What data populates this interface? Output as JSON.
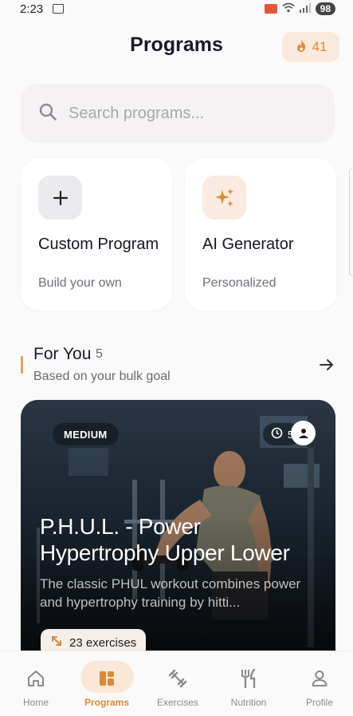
{
  "status_bar": {
    "time": "2:23",
    "battery": "98"
  },
  "header": {
    "title": "Programs",
    "streak_count": "41"
  },
  "search": {
    "placeholder": "Search programs..."
  },
  "quick_actions": [
    {
      "title": "Custom Program",
      "subtitle": "Build your own",
      "icon": "plus-icon"
    },
    {
      "title": "AI Generator",
      "subtitle": "Personalized",
      "icon": "sparkle-icon"
    }
  ],
  "for_you": {
    "title": "For You",
    "count": "5",
    "subtitle": "Based on your bulk goal"
  },
  "featured_program": {
    "difficulty": "MEDIUM",
    "duration": "5",
    "title": "P.H.U.L. - Power Hypertrophy Upper Lower",
    "description": "The classic PHUL workout combines power and hypertrophy training by hitti...",
    "exercises": "23 exercises"
  },
  "nav": [
    {
      "label": "Home",
      "icon": "home-icon"
    },
    {
      "label": "Programs",
      "icon": "programs-icon",
      "active": true
    },
    {
      "label": "Exercises",
      "icon": "dumbbell-icon"
    },
    {
      "label": "Nutrition",
      "icon": "fork-knife-icon"
    },
    {
      "label": "Profile",
      "icon": "person-icon"
    }
  ],
  "colors": {
    "accent": "#d98a3a",
    "accent_bg": "#fbe7d8"
  }
}
